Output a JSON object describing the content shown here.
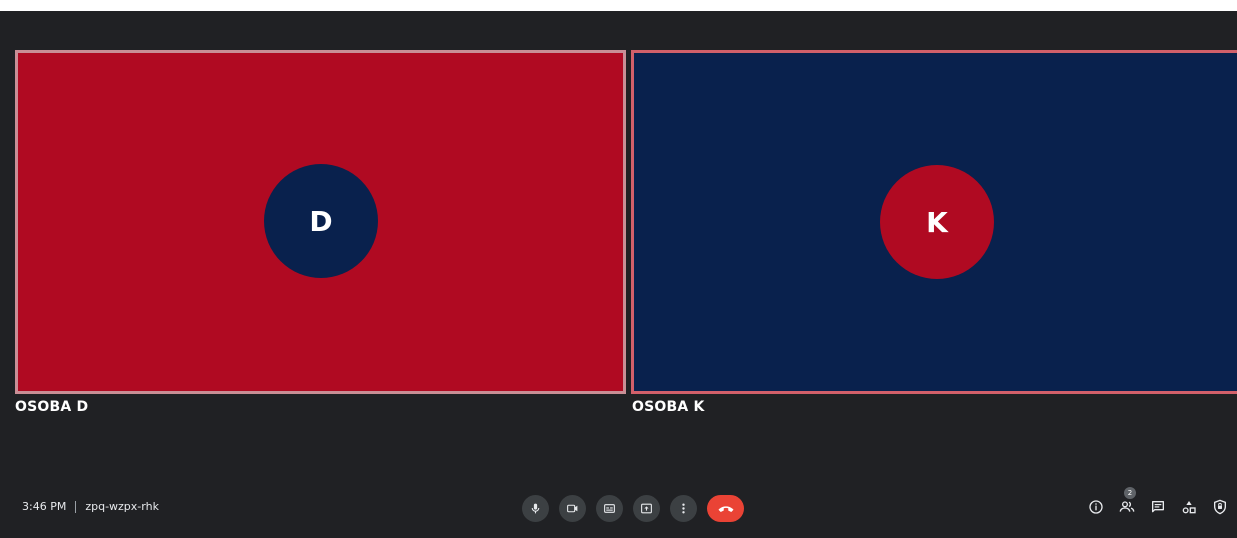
{
  "participants": [
    {
      "name": "OSOBA D",
      "initial": "D",
      "tile_color": "#b00a22",
      "avatar_color": "#09214d",
      "border_color": "#c98f96"
    },
    {
      "name": "OSOBA K",
      "initial": "K",
      "tile_color": "#09214d",
      "avatar_color": "#b00a22",
      "border_color": "#d2606a"
    }
  ],
  "footer": {
    "time": "3:46 PM",
    "meeting_code": "zpq-wzpx-rhk"
  },
  "controls": {
    "items": [
      "microphone-icon",
      "camera-icon",
      "captions-icon",
      "present-icon",
      "more-options-icon",
      "hang-up-icon"
    ]
  },
  "side_controls": {
    "items": [
      "info-icon",
      "people-icon",
      "chat-icon",
      "activities-icon",
      "host-controls-icon"
    ],
    "people_count": "2"
  },
  "colors": {
    "background": "#202124",
    "control_bg": "#3c4043",
    "hangup": "#ea4335"
  }
}
